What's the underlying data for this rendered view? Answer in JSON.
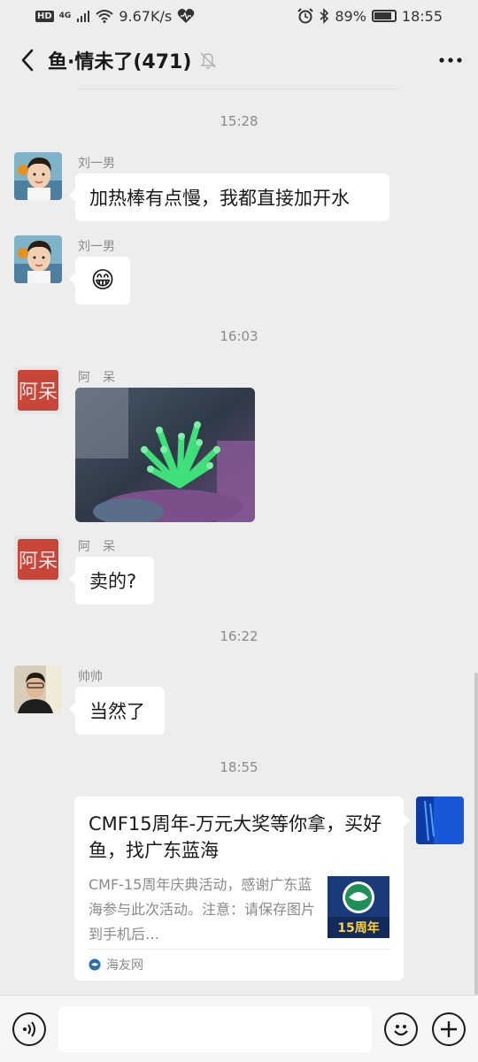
{
  "status_bar": {
    "hd": "HD",
    "network": "4G",
    "speed": "9.67K/s",
    "battery_percent": "89%",
    "battery_level": 0.89,
    "time": "18:55"
  },
  "header": {
    "title": "鱼·情未了(471)"
  },
  "messages": {
    "t1": "15:28",
    "m1_sender": "刘一男",
    "m1_text": "加热棒有点慢，我都直接加开水",
    "m2_sender": "刘一男",
    "m2_emoji": "😁",
    "t2": "16:03",
    "m3_sender": "阿　呆",
    "m4_sender": "阿　呆",
    "m4_text": "卖的?",
    "t3": "16:22",
    "m5_sender": "帅帅",
    "m5_text": "当然了",
    "t4": "18:55"
  },
  "avatar_art": {
    "adai_logo_text": "阿呆"
  },
  "link_card": {
    "title": "CMF15周年-万元大奖等你拿，买好鱼，找广东蓝海",
    "description": "CMF-15周年庆典活动，感谢广东蓝海参与此次活动。注意：请保存图片到手机后…",
    "thumb_text": "15周年",
    "source": "海友网"
  },
  "colors": {
    "background": "#ededed",
    "bubble": "#ffffff",
    "coral": "#3fe07a"
  },
  "icons": {
    "back": "chevron-left-icon",
    "mute": "bell-off-icon",
    "more": "more-dots-icon",
    "voice": "voice-icon",
    "emoji": "emoji-icon",
    "plus": "plus-icon"
  }
}
